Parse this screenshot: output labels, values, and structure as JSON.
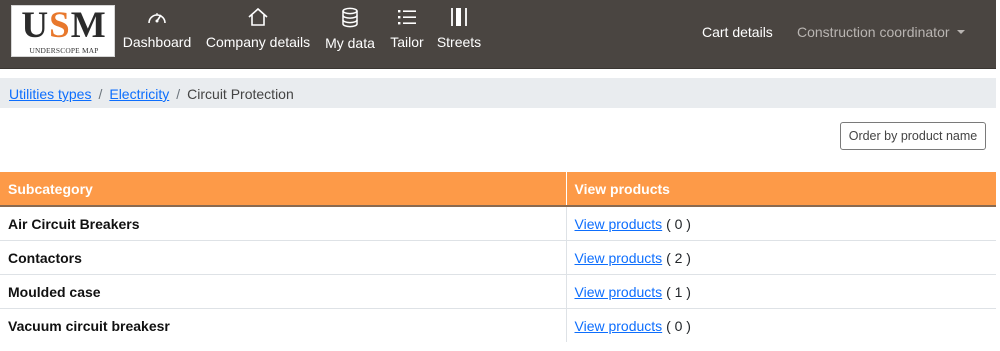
{
  "app": {
    "logo_big": {
      "u": "U",
      "s": "S",
      "m": "M"
    },
    "logo_small": "UNDERSCOPE MAP"
  },
  "nav": {
    "items": [
      {
        "label": "Dashboard",
        "icon": "dashboard-gauge-icon"
      },
      {
        "label": "Company details",
        "icon": "house-icon"
      },
      {
        "label": "My data",
        "icon": "database-icon"
      },
      {
        "label": "Tailor",
        "icon": "list-icon"
      },
      {
        "label": "Streets",
        "icon": "columns-icon"
      }
    ],
    "cart_label": "Cart details",
    "user_label": "Construction coordinator"
  },
  "breadcrumb": {
    "items": [
      "Utilities types",
      "Electricity",
      "Circuit Protection"
    ],
    "separator": "/"
  },
  "order_button_label": "Order by product name",
  "table": {
    "headers": [
      "Subcategory",
      "View products"
    ],
    "link_label": "View products",
    "rows": [
      {
        "subcategory": "Air Circuit Breakers",
        "count": "( 0 )"
      },
      {
        "subcategory": "Contactors",
        "count": "( 2 )"
      },
      {
        "subcategory": "Moulded case",
        "count": "( 1 )"
      },
      {
        "subcategory": "Vacuum circuit breakesr",
        "count": "( 0 )"
      }
    ]
  },
  "colors": {
    "navbar": "#4a4541",
    "accent_orange": "#fd9a48",
    "link_blue": "#0d6efd",
    "breadcrumb_bg": "#e9ecef"
  }
}
